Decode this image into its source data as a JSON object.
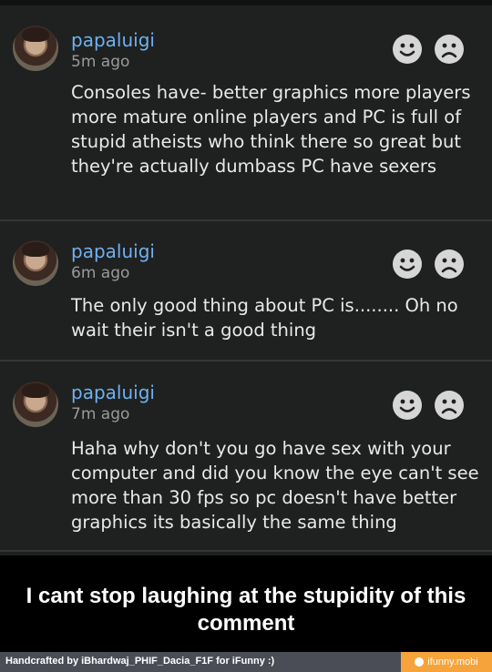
{
  "comments": [
    {
      "username": "papaluigi",
      "time": "5m ago",
      "text": "Consoles have- better graphics more players more mature online players and PC is full of stupid atheists who think there so great but they're actually dumbass PC have sexers"
    },
    {
      "username": "papaluigi",
      "time": "6m ago",
      "text": "The only good thing about PC is........ Oh no wait their isn't a good thing"
    },
    {
      "username": "papaluigi",
      "time": "7m ago",
      "text": "Haha why don't you go have sex with your computer and did you know the eye can't see more than 30 fps so pc doesn't have better graphics its basically the same thing"
    }
  ],
  "caption": "I cant stop laughing at the stupidity of this comment",
  "footer": {
    "credit": "Handcrafted by iBhardwaj_PHIF_Dacia_F1F for iFunny :)",
    "brand": "ifunny.mobi"
  },
  "icons": {
    "like": "smile-icon",
    "dislike": "frown-icon"
  },
  "colors": {
    "username": "#6fb1f0",
    "background": "#1f2020",
    "brand": "#f6a33c"
  }
}
